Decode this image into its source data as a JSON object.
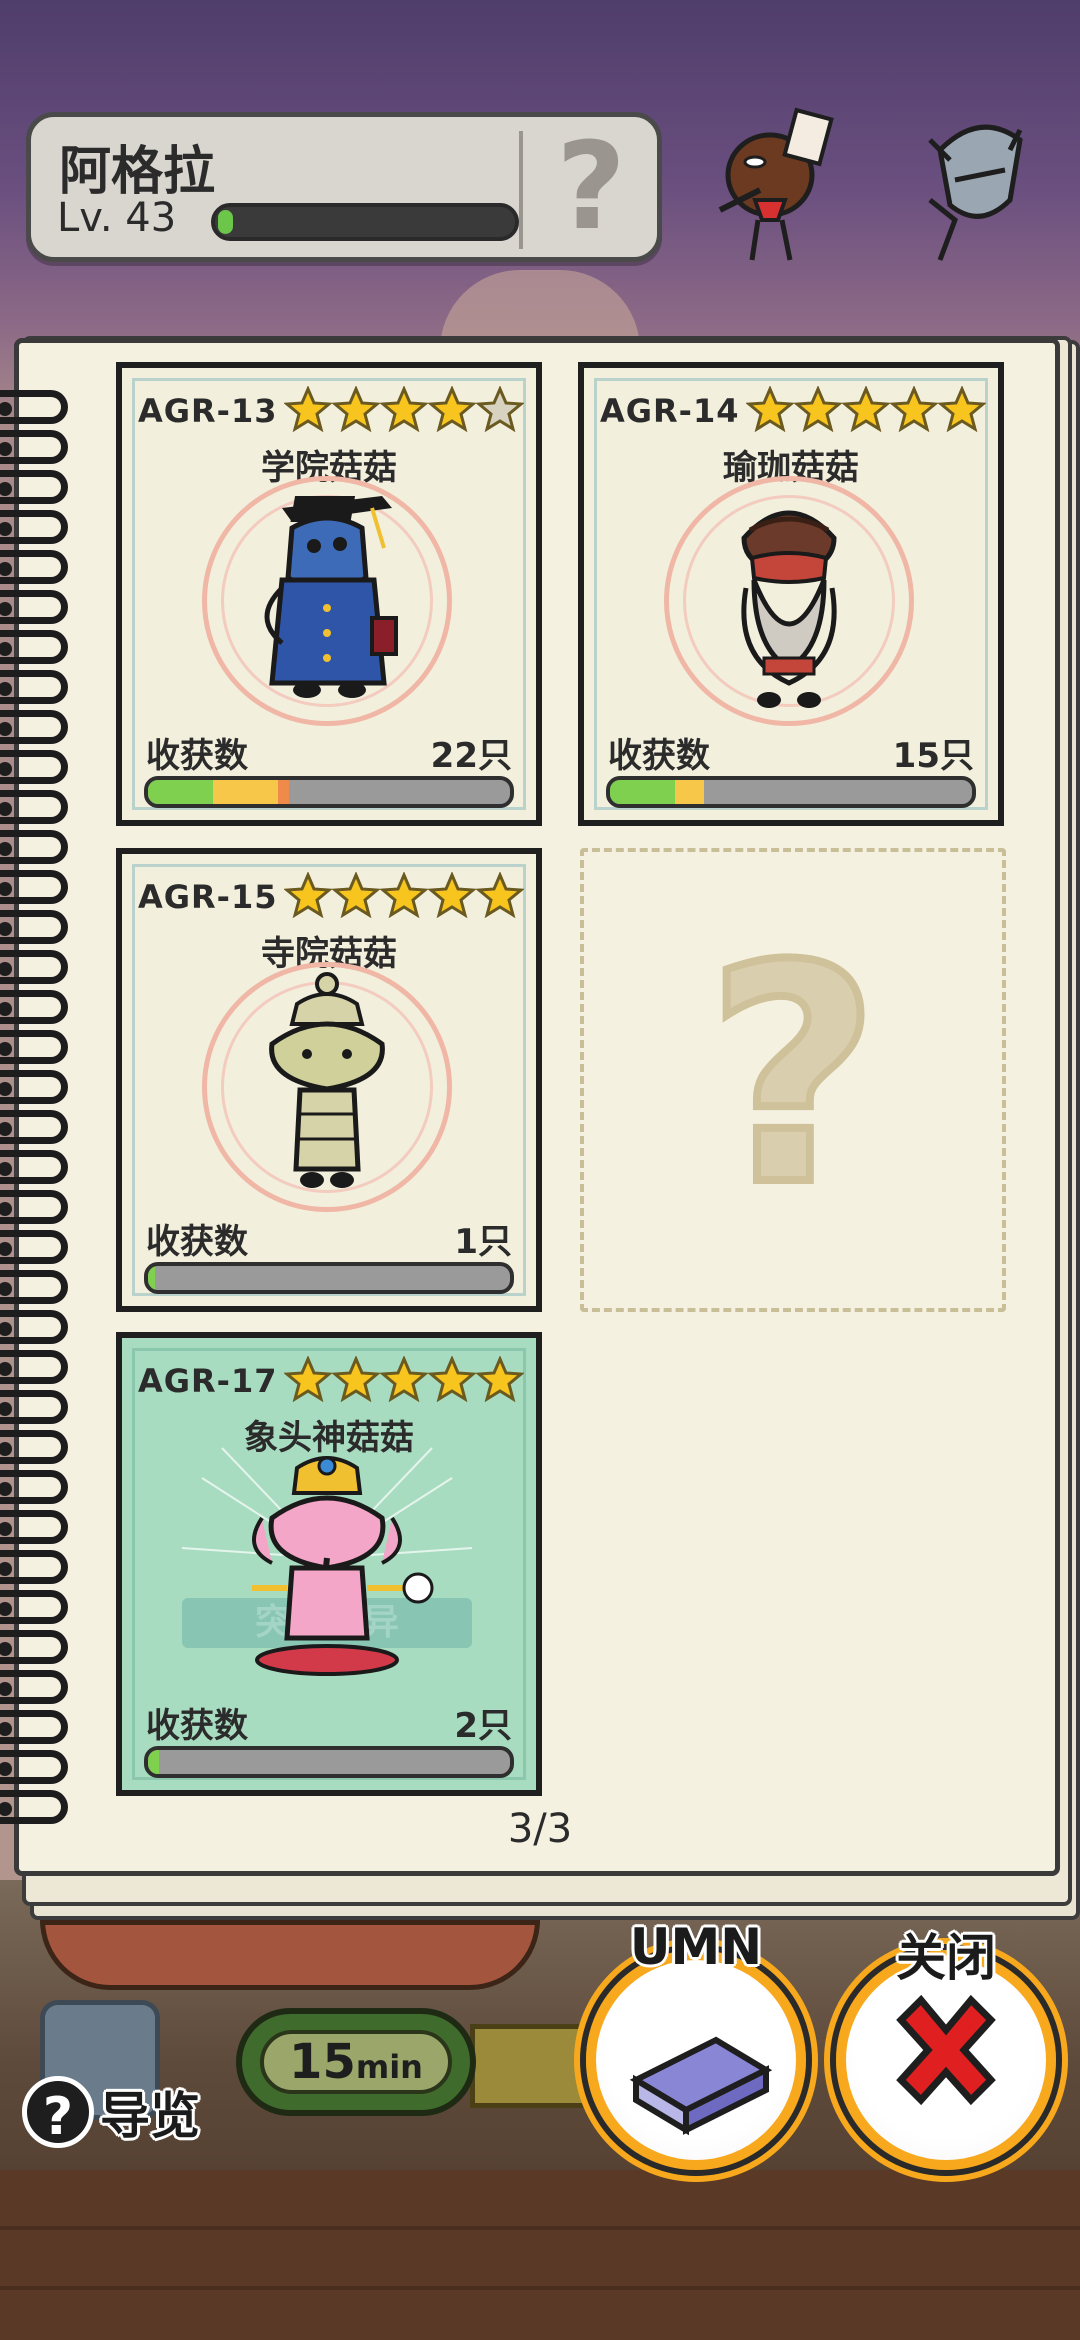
{
  "player": {
    "name": "阿格拉",
    "level_label": "Lv. 43",
    "level_progress": 0.05,
    "help_label": "?"
  },
  "cards": [
    {
      "code": "AGR-13",
      "stars": 4,
      "max_stars": 5,
      "name": "学院菇菇",
      "harvest_label": "收获数",
      "harvest_count": "22只",
      "progress_segments": [
        {
          "color": "#7ed04e",
          "fraction": 0.18
        },
        {
          "color": "#f7c74a",
          "fraction": 0.18
        },
        {
          "color": "#f08a4a",
          "fraction": 0.03
        }
      ],
      "art": "scholar-mushroom",
      "special": false
    },
    {
      "code": "AGR-14",
      "stars": 5,
      "max_stars": 5,
      "name": "瑜珈菇菇",
      "harvest_label": "收获数",
      "harvest_count": "15只",
      "progress_segments": [
        {
          "color": "#7ed04e",
          "fraction": 0.18
        },
        {
          "color": "#f7c74a",
          "fraction": 0.08
        }
      ],
      "art": "yoga-mushroom",
      "special": false
    },
    {
      "code": "AGR-15",
      "stars": 5,
      "max_stars": 5,
      "name": "寺院菇菇",
      "harvest_label": "收获数",
      "harvest_count": "1只",
      "progress_segments": [
        {
          "color": "#7ed04e",
          "fraction": 0.02
        }
      ],
      "art": "temple-mushroom",
      "special": false
    },
    {
      "code": "AGR-17",
      "stars": 5,
      "max_stars": 5,
      "name": "象头神菇菇",
      "harvest_label": "收获数",
      "harvest_count": "2只",
      "progress_segments": [
        {
          "color": "#7ed04e",
          "fraction": 0.03
        }
      ],
      "art": "ganesha-mushroom",
      "special": true,
      "stamp_text": "突然变异"
    }
  ],
  "empty_slot_label": "?",
  "page_indicator": "3/3",
  "bottom": {
    "guide_label": "导览",
    "timer_value": "15",
    "timer_unit": "min",
    "umn_label": "UMN",
    "close_label": "关闭"
  },
  "colors": {
    "star": "#f7c51e",
    "star_empty": "#d8d2c0",
    "accent_orange": "#f7a81c",
    "close_red": "#e02020"
  }
}
